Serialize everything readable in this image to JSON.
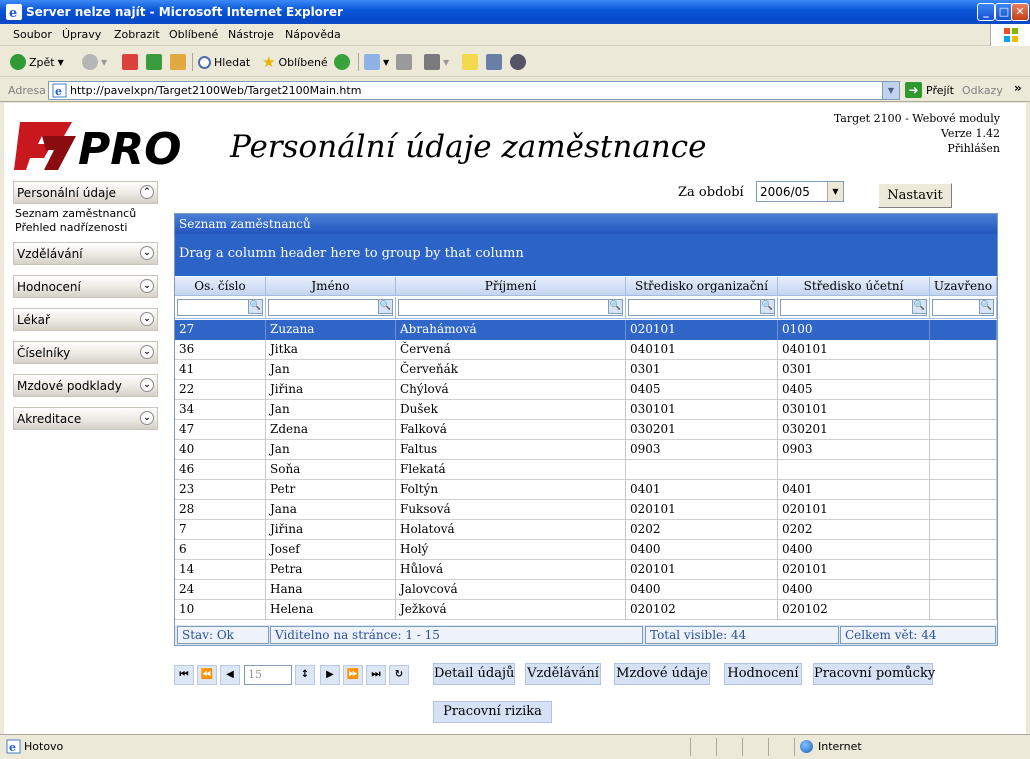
{
  "window": {
    "title": "Server nelze najít - Microsoft Internet Explorer",
    "min_glyph": "_",
    "max_glyph": "□",
    "close_glyph": "✕"
  },
  "menu": [
    "Soubor",
    "Úpravy",
    "Zobrazit",
    "Oblíbené",
    "Nástroje",
    "Nápověda"
  ],
  "toolbar": {
    "back_label": "Zpět",
    "search_label": "Hledat",
    "favorites_label": "Oblíbené"
  },
  "address": {
    "label": "Adresa",
    "url": "http://pavelxpn/Target2100Web/Target2100Main.htm",
    "go_label": "Přejít",
    "links_label": "Odkazy",
    "more": "»"
  },
  "header": {
    "logo_text": "PRO",
    "title": "Personální údaje zaměstnance",
    "app_name": "Target 2100 - Webové moduly",
    "version": "Verze 1.42",
    "logged": "Přihlášen"
  },
  "sidebar": {
    "sections": [
      {
        "label": "Personální údaje",
        "expanded": true,
        "items": [
          "Seznam zaměstnanců",
          "Přehled nadřízenosti"
        ]
      },
      {
        "label": "Vzdělávání",
        "expanded": false
      },
      {
        "label": "Hodnocení",
        "expanded": false
      },
      {
        "label": "Lékař",
        "expanded": false
      },
      {
        "label": "Číselníky",
        "expanded": false
      },
      {
        "label": "Mzdové podklady",
        "expanded": false
      },
      {
        "label": "Akreditace",
        "expanded": false
      }
    ],
    "chev_up": "⌃",
    "chev_down": "⌄"
  },
  "period": {
    "label": "Za období",
    "value": "2006/05",
    "set_label": "Nastavit"
  },
  "grid": {
    "caption": "Seznam zaměstnanců",
    "group_hint": "Drag a column header here to group by that column",
    "columns": [
      "Os. číslo",
      "Jméno",
      "Příjmení",
      "Středisko organizační",
      "Středisko účetní",
      "Uzavřeno"
    ],
    "rows": [
      [
        "27",
        "Zuzana",
        "Abrahámová",
        "020101",
        "0100",
        ""
      ],
      [
        "36",
        "Jitka",
        "Červená",
        "040101",
        "040101",
        ""
      ],
      [
        "41",
        "Jan",
        "Červeňák",
        "0301",
        "0301",
        ""
      ],
      [
        "22",
        "Jiřina",
        "Chýlová",
        "0405",
        "0405",
        ""
      ],
      [
        "34",
        "Jan",
        "Dušek",
        "030101",
        "030101",
        ""
      ],
      [
        "47",
        "Zdena",
        "Falková",
        "030201",
        "030201",
        ""
      ],
      [
        "40",
        "Jan",
        "Faltus",
        "0903",
        "0903",
        ""
      ],
      [
        "46",
        "Soňa",
        "Flekatá",
        "",
        "",
        ""
      ],
      [
        "23",
        "Petr",
        "Foltýn",
        "0401",
        "0401",
        ""
      ],
      [
        "28",
        "Jana",
        "Fuksová",
        "020101",
        "020101",
        ""
      ],
      [
        "7",
        "Jiřina",
        "Holatová",
        "0202",
        "0202",
        ""
      ],
      [
        "6",
        "Josef",
        "Holý",
        "0400",
        "0400",
        ""
      ],
      [
        "14",
        "Petra",
        "Hůlová",
        "020101",
        "020101",
        ""
      ],
      [
        "24",
        "Hana",
        "Jalovcová",
        "0400",
        "0400",
        ""
      ],
      [
        "10",
        "Helena",
        "Ježková",
        "020102",
        "020102",
        ""
      ]
    ],
    "selected_row": 0,
    "status": [
      "Stav: Ok",
      "Viditelno na stránce: 1 - 15",
      "Total visible: 44",
      "Celkem vět: 44"
    ]
  },
  "pager": {
    "page_size": "15",
    "buttons": [
      "⏮",
      "⏪",
      "◀",
      "↕",
      "▶",
      "⏩",
      "⏭",
      "↻"
    ]
  },
  "actions": [
    "Detail údajů",
    "Vzdělávání",
    "Mzdové údaje",
    "Hodnocení",
    "Pracovní pomůcky",
    "Pracovní rizika"
  ],
  "statusbar": {
    "left": "Hotovo",
    "zone": "Internet"
  }
}
